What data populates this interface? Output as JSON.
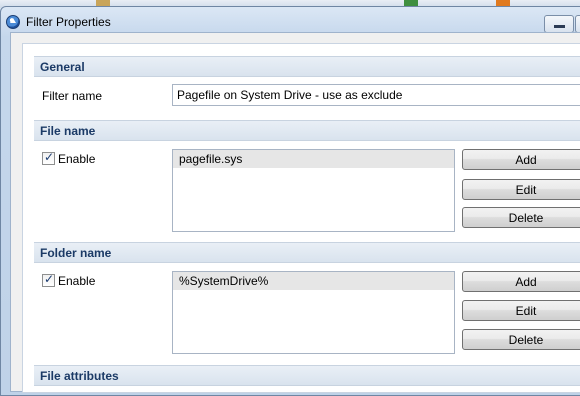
{
  "window": {
    "title": "Filter Properties"
  },
  "general": {
    "header": "General",
    "filter_name_label": "Filter name",
    "filter_name_value": "Pagefile on System Drive - use as exclude"
  },
  "file_name": {
    "header": "File name",
    "enable_label": "Enable",
    "enabled": true,
    "items": [
      "pagefile.sys"
    ],
    "add_label": "Add",
    "edit_label": "Edit",
    "delete_label": "Delete"
  },
  "folder_name": {
    "header": "Folder name",
    "enable_label": "Enable",
    "enabled": true,
    "items": [
      "%SystemDrive%"
    ],
    "add_label": "Add",
    "edit_label": "Edit",
    "delete_label": "Delete"
  },
  "file_attributes": {
    "header": "File attributes"
  },
  "icons": {
    "title": "app-logo-icon",
    "minimize": "minimize-icon",
    "maximize": "maximize-icon",
    "check": "checkmark-icon"
  }
}
